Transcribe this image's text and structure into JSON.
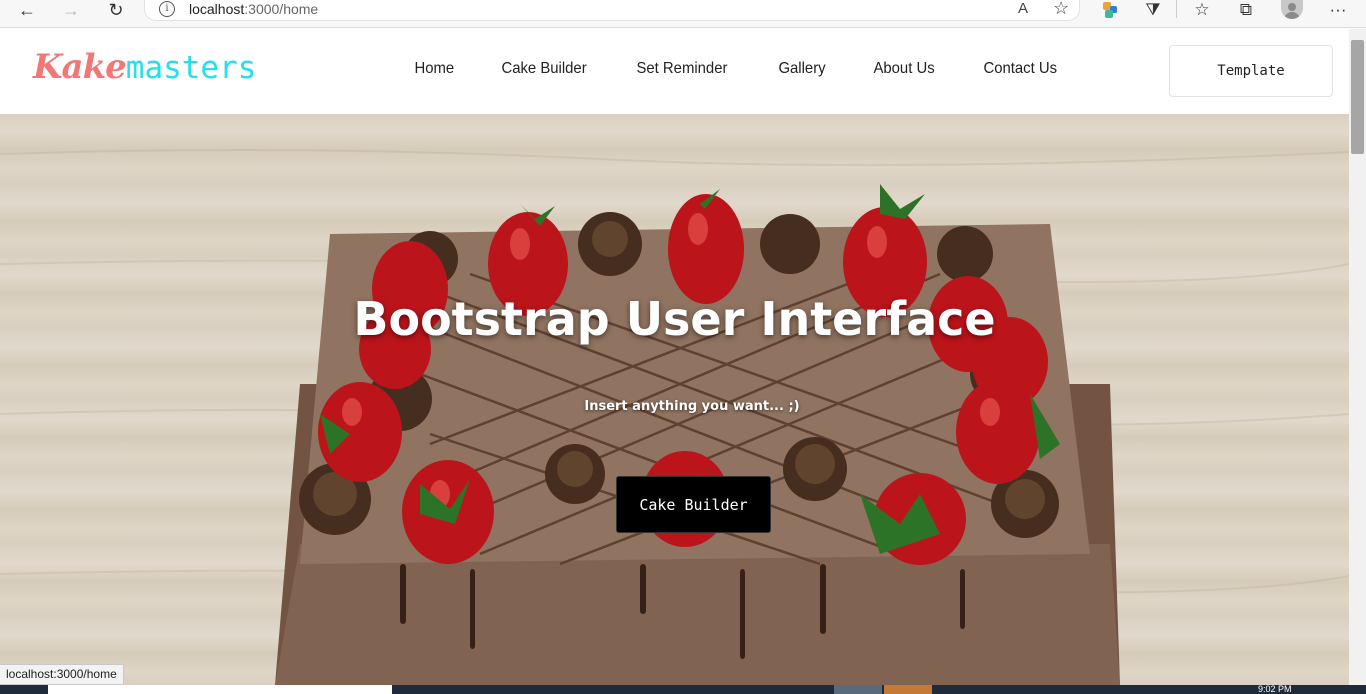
{
  "browser": {
    "url_host": "localhost",
    "url_rest": ":3000/home",
    "back_icon": "←",
    "forward_icon": "→",
    "refresh_icon": "↻",
    "info_icon": "i",
    "read_aloud_icon": "A",
    "favorite_icon": "☆",
    "favorites_icon": "☆",
    "collections_icon": "⧉",
    "extensions_icon": "⧩",
    "menu_icon": "···"
  },
  "site": {
    "brand_part1": "Kake",
    "brand_part2": "masters",
    "nav": [
      "Home",
      "Cake Builder",
      "Set Reminder",
      "Gallery",
      "About Us",
      "Contact Us"
    ],
    "template_button": "Template"
  },
  "hero": {
    "title": "Bootstrap User Interface",
    "subtitle": "Insert anything you want... ;)",
    "button": "Cake Builder"
  },
  "status_link": "localhost:3000/home",
  "taskbar": {
    "clock": "9:02 PM"
  },
  "colors": {
    "brand_part1": "#f27878",
    "brand_part2": "#23e0ec",
    "hero_button_bg": "#000000"
  }
}
